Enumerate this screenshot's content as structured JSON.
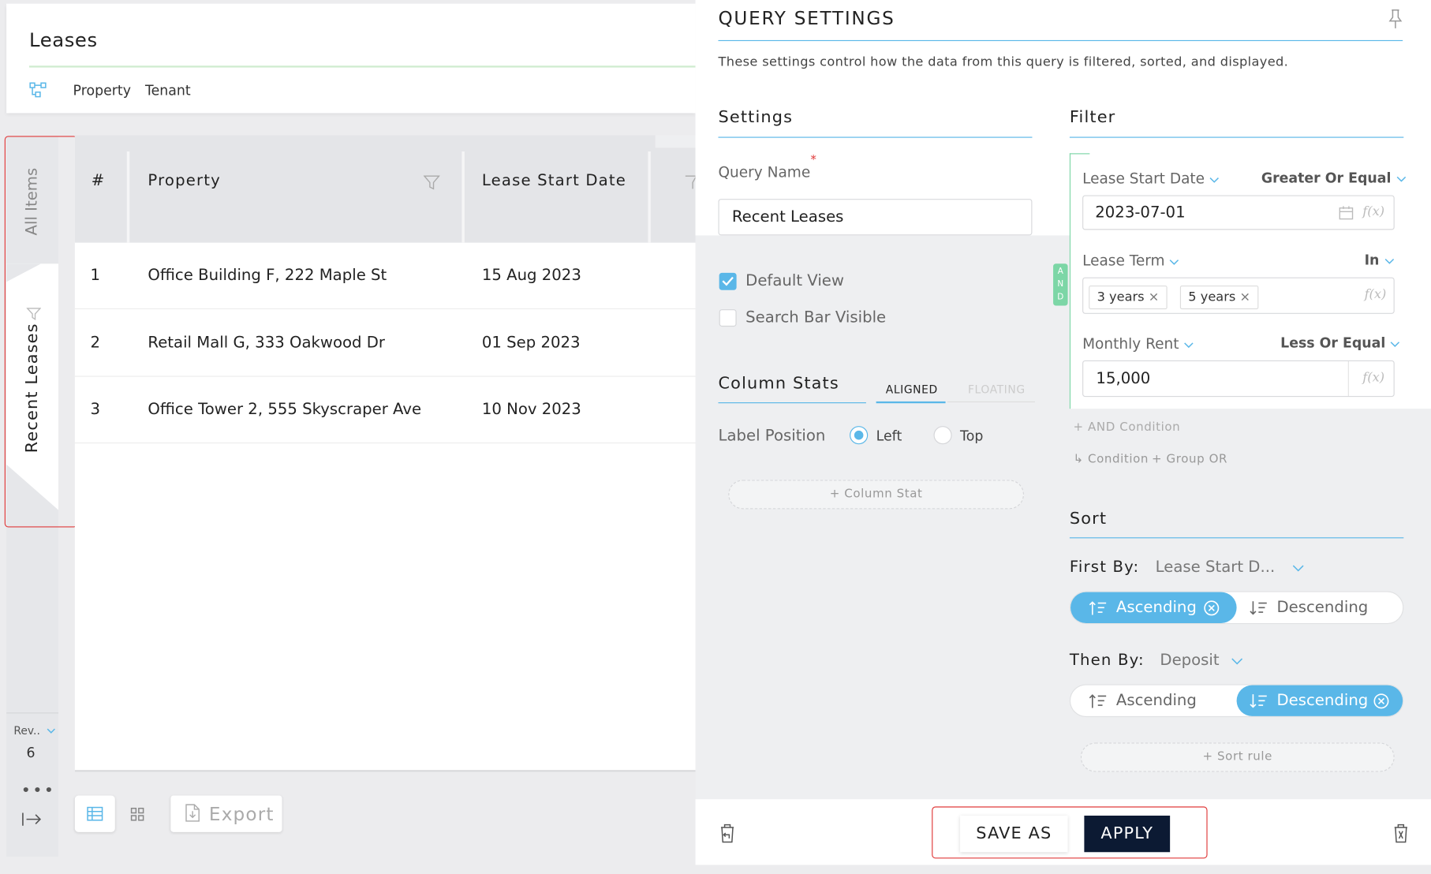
{
  "header": {
    "title": "Leases",
    "nav": [
      "Property",
      "Tenant"
    ]
  },
  "vtabs": {
    "all_items": "All Items",
    "recent_leases": "Recent Leases"
  },
  "rev": {
    "label": "Rev..",
    "value": "6"
  },
  "table": {
    "columns": [
      "#",
      "Property",
      "Lease Start Date"
    ],
    "rows": [
      {
        "num": "1",
        "property": "Office Building F, 222 Maple St",
        "date": "15 Aug 2023"
      },
      {
        "num": "2",
        "property": "Retail Mall G, 333 Oakwood Dr",
        "date": "01 Sep 2023"
      },
      {
        "num": "3",
        "property": "Office Tower 2, 555 Skyscraper Ave",
        "date": "10 Nov 2023"
      }
    ]
  },
  "bottom": {
    "export_label": "Export"
  },
  "panel": {
    "title": "QUERY SETTINGS",
    "description": "These settings control how the data from this query is filtered, sorted, and displayed.",
    "settings": {
      "title": "Settings",
      "query_name_label": "Query Name",
      "required_mark": "*",
      "query_name_value": "Recent Leases",
      "default_view": "Default View",
      "search_bar_visible": "Search Bar Visible"
    },
    "column_stats": {
      "title": "Column Stats",
      "tab_aligned": "ALIGNED",
      "tab_floating": "FLOATING",
      "label_position": "Label Position",
      "opt_left": "Left",
      "opt_top": "Top",
      "add_column_stat": "+ Column Stat"
    },
    "filter": {
      "title": "Filter",
      "and_badge": [
        "A",
        "N",
        "D"
      ],
      "conditions": [
        {
          "field": "Lease Start Date",
          "operator": "Greater Or Equal",
          "value": "2023-07-01"
        },
        {
          "field": "Lease Term",
          "operator": "In",
          "chips": [
            "3 years",
            "5 years"
          ]
        },
        {
          "field": "Monthly Rent",
          "operator": "Less Or Equal",
          "value": "15,000"
        }
      ],
      "fx": "f(x)",
      "add_and": "+ AND  Condition",
      "add_or_condition": "↳ Condition",
      "add_or_group": "+ Group  OR"
    },
    "sort": {
      "title": "Sort",
      "first_by_label": "First By:",
      "first_by_value": "Lease Start D...",
      "then_by_label": "Then By:",
      "then_by_value": "Deposit",
      "ascending": "Ascending",
      "descending": "Descending",
      "add_sort_rule": "+ Sort rule"
    },
    "footer": {
      "save_as": "SAVE AS",
      "apply": "APPLY"
    }
  },
  "colors": {
    "accent": "#5ab7e8",
    "apply_bg": "#0c1a33",
    "highlight": "#e03a3a"
  }
}
